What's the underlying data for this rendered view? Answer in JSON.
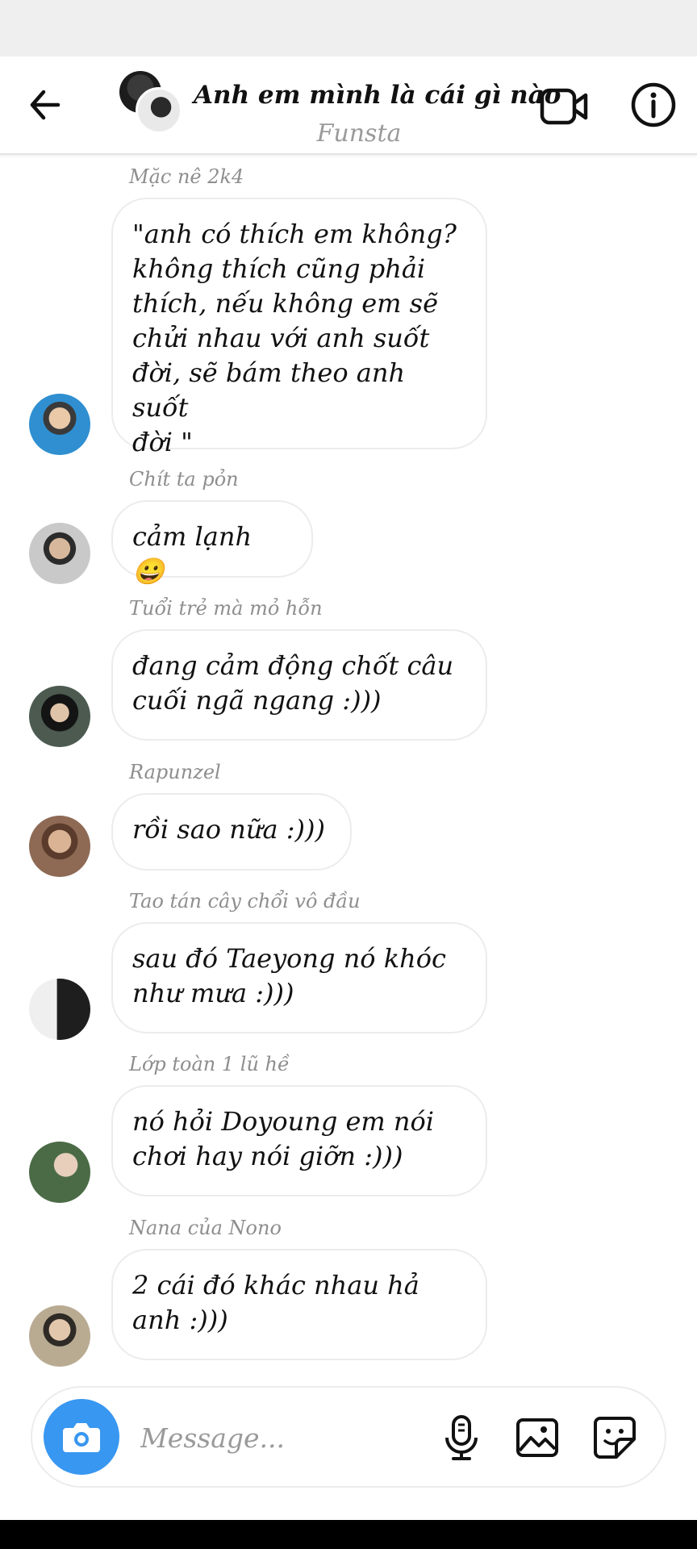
{
  "header": {
    "title": "Anh em mình là cái gì nào",
    "subtitle": "Funsta"
  },
  "messages": [
    {
      "sender": "Mặc nê 2k4",
      "lines": [
        "\"anh có thích em không?",
        "không thích cũng phải",
        "thích, nếu không em sẽ",
        "chửi nhau với anh suốt",
        "đời, sẽ bám theo anh suốt",
        "đời \""
      ]
    },
    {
      "sender": "Chít ta pỏn",
      "lines": [
        "cảm lạnh 😀"
      ]
    },
    {
      "sender": "Tuổi trẻ mà mỏ hỗn",
      "lines": [
        "đang cảm động chốt câu",
        "cuối ngã ngang :)))"
      ]
    },
    {
      "sender": "Rapunzel",
      "lines": [
        "rồi sao nữa :)))"
      ]
    },
    {
      "sender": "Tao tán cây chổi vô đầu",
      "lines": [
        "sau đó Taeyong nó khóc",
        "như mưa :)))"
      ]
    },
    {
      "sender": "Lớp toàn 1 lũ hề",
      "lines": [
        "nó hỏi Doyoung em nói",
        "chơi hay nói giỡn :)))"
      ]
    },
    {
      "sender": "Nana của Nono",
      "lines": [
        "2 cái đó khác nhau hả",
        "anh :)))"
      ]
    }
  ],
  "composer": {
    "placeholder": "Message..."
  },
  "colors": {
    "accent": "#3897f0",
    "bubble_border": "#ececec",
    "muted_text": "#8e8e8e"
  },
  "icons": [
    "back-arrow-icon",
    "video-call-icon",
    "info-icon",
    "camera-icon",
    "microphone-icon",
    "gallery-icon",
    "sticker-icon"
  ]
}
